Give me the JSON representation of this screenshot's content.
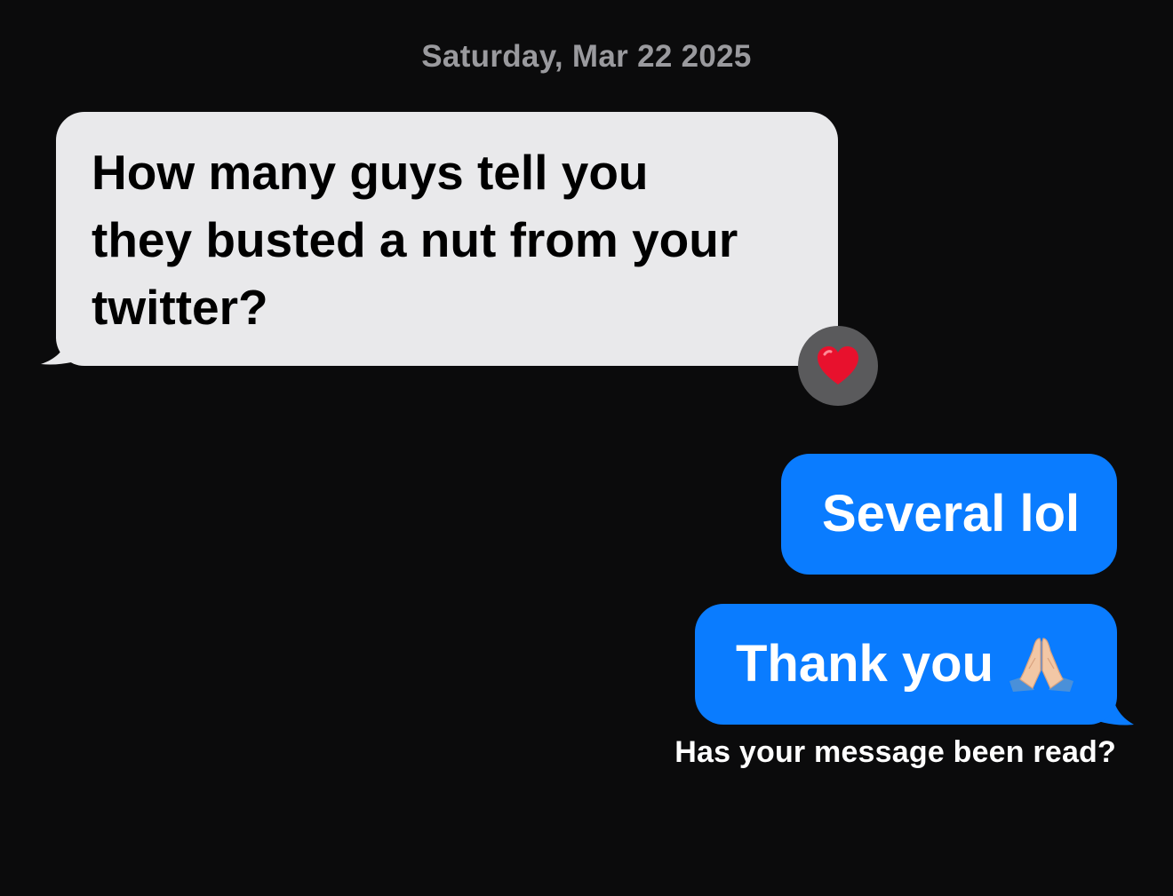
{
  "conversation": {
    "timestamp": "Saturday, Mar 22 2025",
    "incoming": {
      "lines": [
        "How many guys tell you",
        "they busted a nut from your",
        "twitter?"
      ],
      "reaction": "heart-icon"
    },
    "outgoing": [
      {
        "text": "Several lol"
      },
      {
        "text": "Thank you",
        "emoji": "folded-hands-icon"
      }
    ],
    "overlay_caption": "Has your message been read?"
  },
  "colors": {
    "background": "#0b0b0c",
    "incoming_bubble": "#e9e9eb",
    "outgoing_bubble": "#0a7cff",
    "reaction_badge": "#5a5a5c",
    "heart": "#e8112d"
  }
}
